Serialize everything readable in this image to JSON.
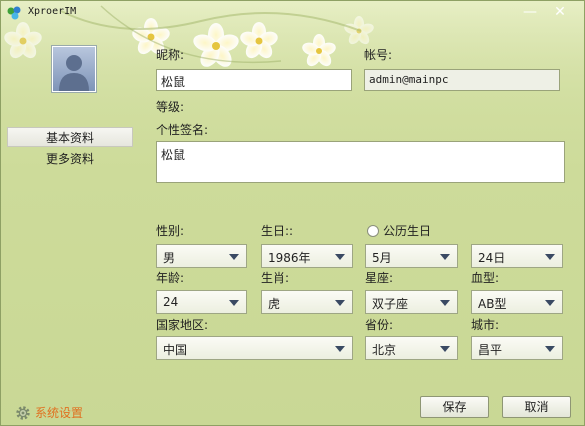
{
  "window": {
    "title": "XproerIM",
    "minimize": "—",
    "close": "✕"
  },
  "nav": {
    "items": [
      {
        "label": "基本资料",
        "active": true
      },
      {
        "label": "更多资料",
        "active": false
      }
    ]
  },
  "form": {
    "nickname": {
      "label": "昵称:",
      "value": "松鼠"
    },
    "account": {
      "label": "帐号:",
      "value": "admin@mainpc"
    },
    "level": {
      "label": "等级:"
    },
    "signature": {
      "label": "个性签名:",
      "value": "松鼠"
    },
    "gender": {
      "label": "性别:",
      "value": "男"
    },
    "birthday": {
      "label": "生日::",
      "year": "1986年",
      "month": "5月",
      "day": "24日"
    },
    "solar_birthday": {
      "label": "公历生日",
      "checked": false
    },
    "age": {
      "label": "年龄:",
      "value": "24"
    },
    "zodiac": {
      "label": "生肖:",
      "value": "虎"
    },
    "constellation": {
      "label": "星座:",
      "value": "双子座"
    },
    "blood": {
      "label": "血型:",
      "value": "AB型"
    },
    "country": {
      "label": "国家地区:",
      "value": "中国"
    },
    "province": {
      "label": "省份:",
      "value": "北京"
    },
    "city": {
      "label": "城市:",
      "value": "昌平"
    }
  },
  "footer": {
    "settings_label": "系统设置",
    "save_label": "保存",
    "cancel_label": "取消"
  }
}
